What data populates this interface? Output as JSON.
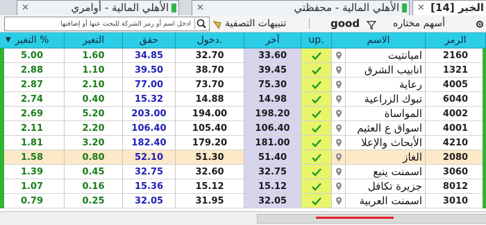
{
  "tabs": [
    {
      "label": "الخير [14]",
      "active": true
    },
    {
      "label": "الأهلي المالية - محفظتي",
      "active": false
    },
    {
      "label": "الأهلي المالية - أوامري",
      "active": false
    }
  ],
  "toolbar": {
    "watchlist_label": "أسهم مختاره",
    "good_label": "good",
    "filter_alerts_label": "تنبيهات التصفية",
    "search_placeholder": "ادخل اسم أو رمز الشركة للبحث عنها أو إضافتها"
  },
  "columns": {
    "symbol": "الرمز",
    "name": "الاسم",
    "up": "up.",
    "last": "آخر",
    "entry": "دخول.",
    "target": "حقق",
    "change": "التغير",
    "change_pct": "التغير %"
  },
  "rows": [
    {
      "symbol": "2160",
      "name": "اميانتيت",
      "last": "33.60",
      "entry": "32.70",
      "target": "34.85",
      "change": "1.60",
      "pct": "5.00",
      "highlight": false
    },
    {
      "symbol": "1321",
      "name": "انابيب الشرق",
      "last": "39.45",
      "entry": "38.70",
      "target": "39.50",
      "change": "1.10",
      "pct": "2.88",
      "highlight": false
    },
    {
      "symbol": "4005",
      "name": "رعاية",
      "last": "75.30",
      "entry": "73.70",
      "target": "77.00",
      "change": "2.10",
      "pct": "2.87",
      "highlight": false
    },
    {
      "symbol": "6040",
      "name": "تبوك الزراعية",
      "last": "14.98",
      "entry": "14.88",
      "target": "15.32",
      "change": "0.40",
      "pct": "2.74",
      "highlight": false
    },
    {
      "symbol": "4002",
      "name": "المواساة",
      "last": "198.20",
      "entry": "194.00",
      "target": "203.00",
      "change": "5.20",
      "pct": "2.69",
      "highlight": false
    },
    {
      "symbol": "4001",
      "name": "اسواق ع العثيم",
      "last": "106.40",
      "entry": "105.40",
      "target": "106.40",
      "change": "2.20",
      "pct": "2.11",
      "highlight": false
    },
    {
      "symbol": "4210",
      "name": "الأبحاث والإعلا",
      "last": "181.00",
      "entry": "179.20",
      "target": "182.40",
      "change": "3.20",
      "pct": "1.81",
      "highlight": false
    },
    {
      "symbol": "2080",
      "name": "الغاز",
      "last": "51.40",
      "entry": "51.30",
      "target": "52.10",
      "change": "0.80",
      "pct": "1.58",
      "highlight": true
    },
    {
      "symbol": "3060",
      "name": "اسمنت ينبع",
      "last": "32.75",
      "entry": "32.60",
      "target": "32.75",
      "change": "0.45",
      "pct": "1.39",
      "highlight": false
    },
    {
      "symbol": "8012",
      "name": "جزيرة تكافل",
      "last": "15.12",
      "entry": "15.12",
      "target": "15.36",
      "change": "0.16",
      "pct": "1.07",
      "highlight": false
    },
    {
      "symbol": "3010",
      "name": "اسمنت العربية",
      "last": "32.05",
      "entry": "31.95",
      "target": "32.05",
      "change": "0.25",
      "pct": "0.79",
      "highlight": false
    }
  ],
  "colors": {
    "header_bg": "#2ccde6",
    "up_column": "#e8f56a",
    "last_column": "#d7d4ee",
    "highlight_row": "#fde8c8",
    "change_text": "#1a7d1a",
    "value_text": "#1f1fb8",
    "side_bar": "#32b432"
  },
  "icons": {
    "check": "check-icon",
    "location": "location-pin-icon",
    "filter": "funnel-icon",
    "search": "search-icon",
    "settings": "gear-icon"
  }
}
